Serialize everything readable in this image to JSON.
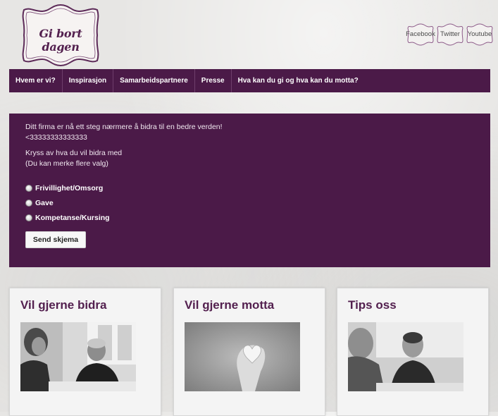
{
  "logo": {
    "text": "Gi bort dagen"
  },
  "social": [
    {
      "label": "Facebook"
    },
    {
      "label": "Twitter"
    },
    {
      "label": "Youtube"
    }
  ],
  "nav": [
    {
      "label": "Hvem er vi?"
    },
    {
      "label": "Inspirasjon"
    },
    {
      "label": "Samarbeidspartnere"
    },
    {
      "label": "Presse"
    },
    {
      "label": "Hva kan du gi og hva kan du motta?"
    }
  ],
  "form": {
    "message_line1": "Ditt firma er nå ett steg nærmere å bidra til en bedre verden!",
    "message_line2": "<33333333333333",
    "prompt_line1": "Kryss av hva du vil bidra med",
    "prompt_line2": "(Du kan merke flere valg)",
    "options": [
      {
        "label": "Frivillighet/Omsorg"
      },
      {
        "label": "Gave"
      },
      {
        "label": "Kompetanse/Kursing"
      }
    ],
    "submit_label": "Send skjema"
  },
  "cards": [
    {
      "title": "Vil gjerne bidra"
    },
    {
      "title": "Vil gjerne motta"
    },
    {
      "title": "Tips oss"
    }
  ],
  "colors": {
    "brand": "#4b1a48",
    "heading": "#53204f"
  }
}
